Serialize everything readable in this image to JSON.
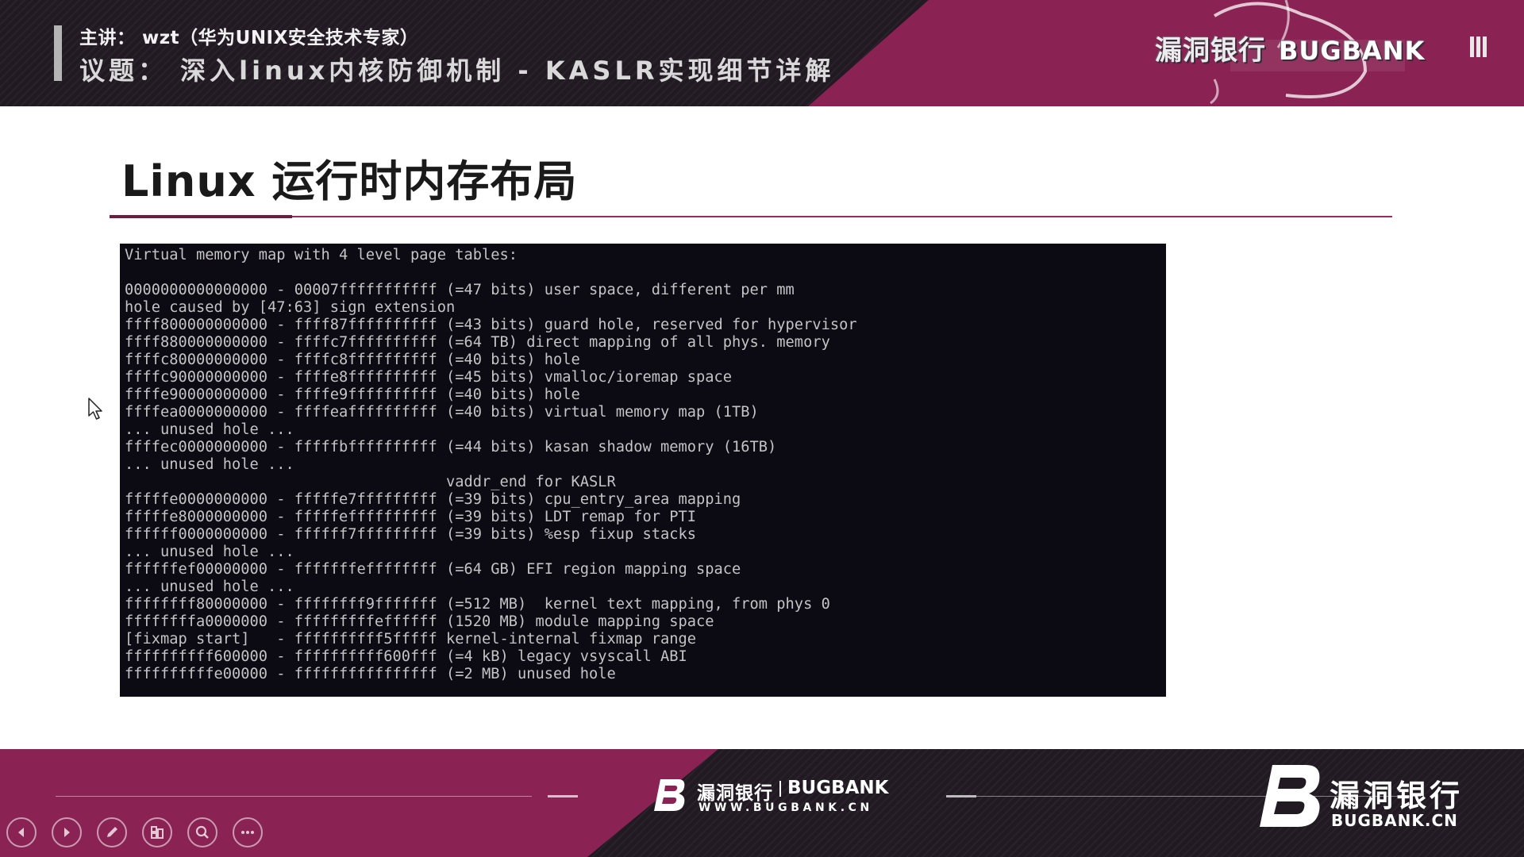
{
  "header": {
    "speaker": "主讲： wzt（华为UNIX安全技术专家）",
    "topic": "议题： 深入linux内核防御机制 - KASLR实现细节详解",
    "brand_cn": "漏洞银行",
    "brand_en": "BUGBANK"
  },
  "slide": {
    "title": "Linux 运行时内存布局",
    "terminal_lines": [
      "Virtual memory map with 4 level page tables:",
      "",
      "0000000000000000 - 00007fffffffffff (=47 bits) user space, different per mm",
      "hole caused by [47:63] sign extension",
      "ffff800000000000 - ffff87ffffffffff (=43 bits) guard hole, reserved for hypervisor",
      "ffff880000000000 - ffffc7ffffffffff (=64 TB) direct mapping of all phys. memory",
      "ffffc80000000000 - ffffc8ffffffffff (=40 bits) hole",
      "ffffc90000000000 - ffffe8ffffffffff (=45 bits) vmalloc/ioremap space",
      "ffffe90000000000 - ffffe9ffffffffff (=40 bits) hole",
      "ffffea0000000000 - ffffeaffffffffff (=40 bits) virtual memory map (1TB)",
      "... unused hole ...",
      "ffffec0000000000 - fffffbffffffffff (=44 bits) kasan shadow memory (16TB)",
      "... unused hole ...",
      "                                    vaddr_end for KASLR",
      "fffffe0000000000 - fffffe7fffffffff (=39 bits) cpu_entry_area mapping",
      "fffffe8000000000 - fffffeffffffffff (=39 bits) LDT remap for PTI",
      "ffffff0000000000 - ffffff7fffffffff (=39 bits) %esp fixup stacks",
      "... unused hole ...",
      "ffffffef00000000 - fffffffeffffffff (=64 GB) EFI region mapping space",
      "... unused hole ...",
      "ffffffff80000000 - ffffffff9fffffff (=512 MB)  kernel text mapping, from phys 0",
      "ffffffffa0000000 - fffffffffeffffff (1520 MB) module mapping space",
      "[fixmap start]   - ffffffffff5fffff kernel-internal fixmap range",
      "ffffffffff600000 - ffffffffff600fff (=4 kB) legacy vsyscall ABI",
      "ffffffffffe00000 - ffffffffffffffff (=2 MB) unused hole"
    ]
  },
  "footer": {
    "center_cn": "漏洞银行",
    "center_en": "BUGBANK",
    "center_url": "WWW.BUGBANK.CN",
    "right_cn": "漏洞银行",
    "right_en": "BUGBANK.CN"
  },
  "toolbar": {
    "icons": [
      "previous-icon",
      "next-icon",
      "pen-icon",
      "slides-icon",
      "zoom-icon",
      "more-icon"
    ]
  },
  "colors": {
    "accent": "#8a2353",
    "banner_dark": "#221a23",
    "terminal_bg": "#0c0a12",
    "terminal_text": "#c4c4c4"
  }
}
